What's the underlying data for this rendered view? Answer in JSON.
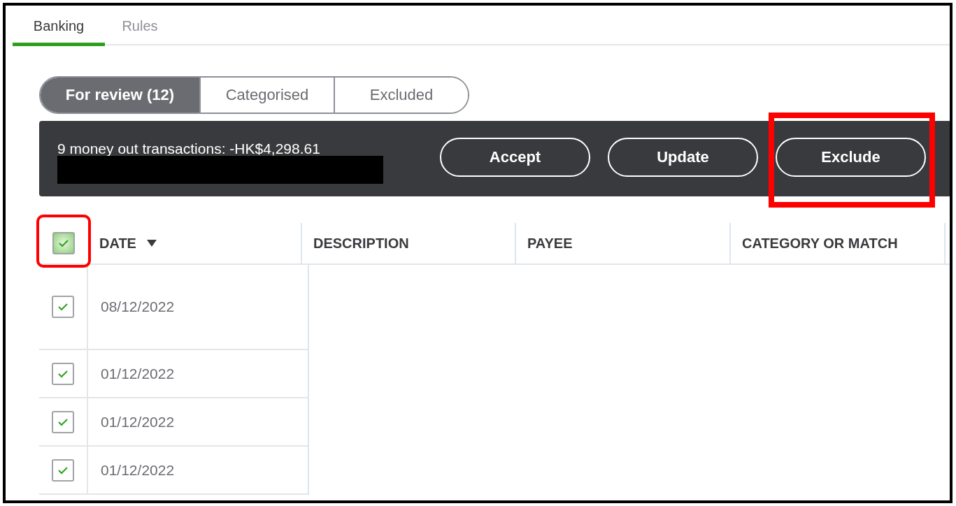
{
  "tabs": [
    {
      "label": "Banking",
      "selected": true
    },
    {
      "label": "Rules",
      "selected": false
    }
  ],
  "review_filter": [
    {
      "label": "For review (12)",
      "selected": true
    },
    {
      "label": "Categorised",
      "selected": false
    },
    {
      "label": "Excluded",
      "selected": false
    }
  ],
  "batch_bar": {
    "summary": "9 money out transactions: -HK$4,298.61",
    "buttons": [
      "Accept",
      "Update",
      "Exclude"
    ]
  },
  "table": {
    "select_all_checked": true,
    "columns": [
      {
        "label": "DATE",
        "sorted": true
      },
      {
        "label": "DESCRIPTION",
        "sorted": false
      },
      {
        "label": "PAYEE",
        "sorted": false
      },
      {
        "label": "CATEGORY OR MATCH",
        "sorted": false
      }
    ],
    "rows": [
      {
        "date": "08/12/2022",
        "checked": true
      },
      {
        "date": "01/12/2022",
        "checked": true
      },
      {
        "date": "01/12/2022",
        "checked": true
      },
      {
        "date": "01/12/2022",
        "checked": true
      }
    ]
  }
}
